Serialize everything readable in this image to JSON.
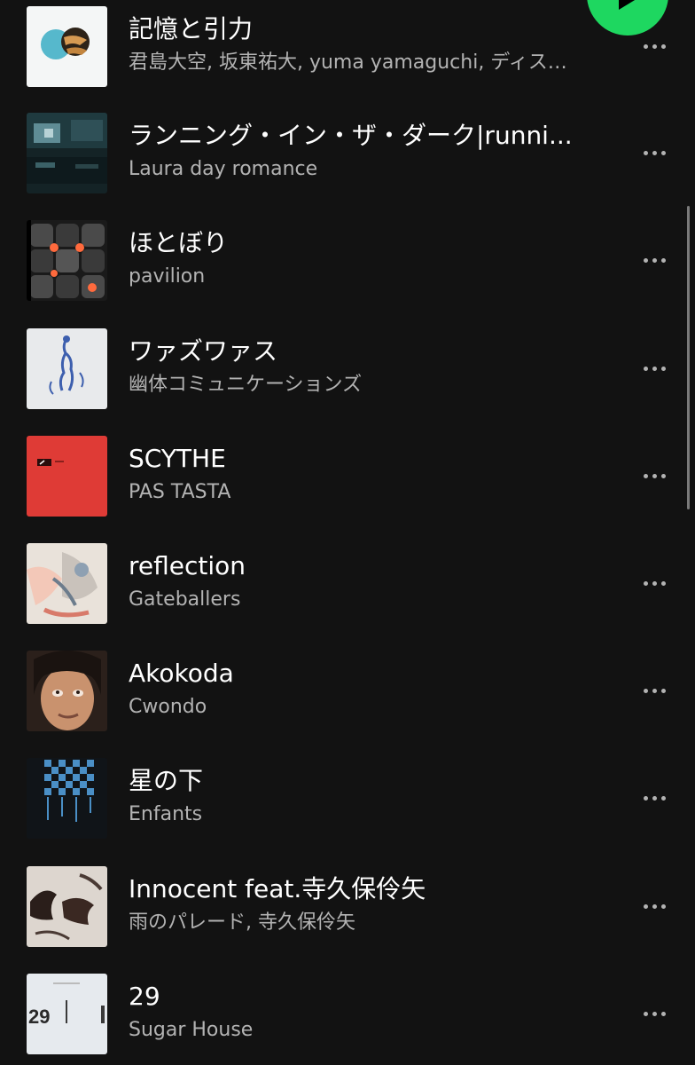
{
  "accent_color": "#1ed760",
  "play_button": {
    "icon": "play-icon"
  },
  "tracks": [
    {
      "title": "記憶と引力",
      "artist": "君島大空, 坂東祐大, yuma yamaguchi, ディス…"
    },
    {
      "title": "ランニング・イン・ザ・ダーク|runni...",
      "artist": "Laura day romance"
    },
    {
      "title": "ほとぼり",
      "artist": "pavilion"
    },
    {
      "title": "ワァズワァス",
      "artist": "幽体コミュニケーションズ"
    },
    {
      "title": "SCYTHE",
      "artist": "PAS TASTA"
    },
    {
      "title": "reflection",
      "artist": "Gateballers"
    },
    {
      "title": "Akokoda",
      "artist": "Cwondo"
    },
    {
      "title": "星の下",
      "artist": "Enfants"
    },
    {
      "title": "Innocent feat.寺久保伶矢",
      "artist": "雨のパレード, 寺久保伶矢"
    },
    {
      "title": "29",
      "artist": "Sugar House",
      "art_text": "29"
    }
  ],
  "more_icon": "more-options-icon"
}
